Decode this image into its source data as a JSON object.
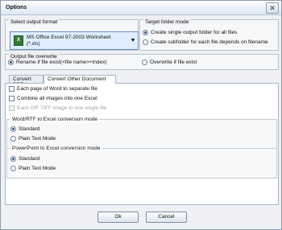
{
  "window": {
    "title": "Options",
    "close_glyph": "✕"
  },
  "output_format": {
    "legend": "Select output format",
    "selected": "MS Office Excel 97-2003 Worksheet (*.xls)",
    "icon": "excel-icon",
    "icon_glyph": "X"
  },
  "target_folder": {
    "legend": "Target folder mode",
    "options": [
      "Create single output folder for all files",
      "Create subfolder for each file depends on filename"
    ],
    "selected_index": 0
  },
  "overwrite": {
    "legend": "Output file overwrite",
    "options": [
      "Rename if file exist(<file name>+index)",
      "Overwrite if file exist"
    ],
    "selected_index": 0
  },
  "tabs": [
    "Convert PDF",
    "Convert Other Document"
  ],
  "active_tab": 1,
  "checkboxes": [
    {
      "label": "Each page of Word to separate file",
      "checked": false,
      "enabled": true
    },
    {
      "label": "Combine all images into one Excel",
      "checked": false,
      "enabled": true
    },
    {
      "label": "Each GIF TIFF image to one single file",
      "checked": false,
      "enabled": false
    }
  ],
  "word_mode": {
    "legend": "Word/RTF to Excel conversion mode",
    "options": [
      "Standard",
      "Plain Text Mode"
    ],
    "selected_index": 0
  },
  "ppt_mode": {
    "legend": "PowerPoint to Excel conversion mode",
    "options": [
      "Standard",
      "Plain Text Mode"
    ],
    "selected_index": 0
  },
  "buttons": {
    "ok": "Ok",
    "cancel": "Cancel"
  }
}
